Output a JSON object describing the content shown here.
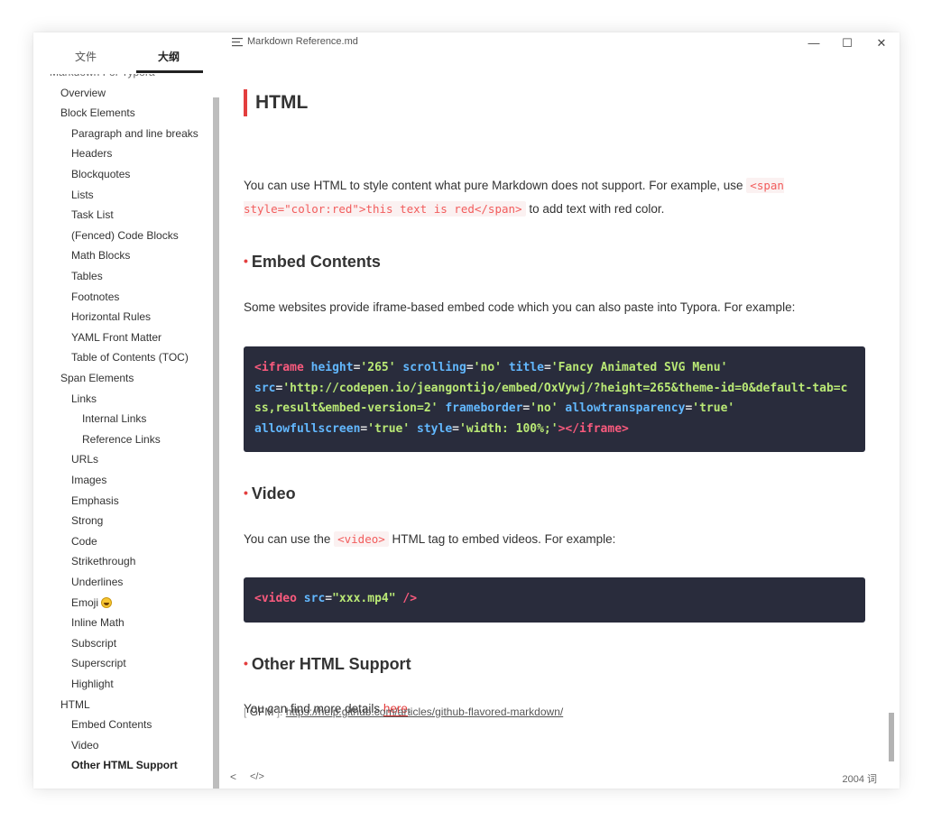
{
  "window": {
    "doc_title": "Markdown Reference.md",
    "buttons": {
      "minimize": "—",
      "maximize": "☐",
      "close": "✕"
    }
  },
  "sidebar": {
    "tabs": [
      {
        "label": "文件",
        "active": false
      },
      {
        "label": "大纲",
        "active": true
      }
    ],
    "outline": [
      {
        "label": "Markdown For Typora",
        "level": 0,
        "partial": true
      },
      {
        "label": "Overview",
        "level": 1
      },
      {
        "label": "Block Elements",
        "level": 1
      },
      {
        "label": "Paragraph and line breaks",
        "level": 2
      },
      {
        "label": "Headers",
        "level": 2
      },
      {
        "label": "Blockquotes",
        "level": 2
      },
      {
        "label": "Lists",
        "level": 2
      },
      {
        "label": "Task List",
        "level": 2
      },
      {
        "label": "(Fenced) Code Blocks",
        "level": 2
      },
      {
        "label": "Math Blocks",
        "level": 2
      },
      {
        "label": "Tables",
        "level": 2
      },
      {
        "label": "Footnotes",
        "level": 2
      },
      {
        "label": "Horizontal Rules",
        "level": 2
      },
      {
        "label": "YAML Front Matter",
        "level": 2
      },
      {
        "label": "Table of Contents (TOC)",
        "level": 2
      },
      {
        "label": "Span Elements",
        "level": 1
      },
      {
        "label": "Links",
        "level": 2
      },
      {
        "label": "Internal Links",
        "level": 3
      },
      {
        "label": "Reference Links",
        "level": 3
      },
      {
        "label": "URLs",
        "level": 2
      },
      {
        "label": "Images",
        "level": 2
      },
      {
        "label": "Emphasis",
        "level": 2
      },
      {
        "label": "Strong",
        "level": 2
      },
      {
        "label": "Code",
        "level": 2
      },
      {
        "label": "Strikethrough",
        "level": 2
      },
      {
        "label": "Underlines",
        "level": 2
      },
      {
        "label": "Emoji",
        "level": 2,
        "emoji": "grinning-face"
      },
      {
        "label": "Inline Math",
        "level": 2
      },
      {
        "label": "Subscript",
        "level": 2
      },
      {
        "label": "Superscript",
        "level": 2
      },
      {
        "label": "Highlight",
        "level": 2
      },
      {
        "label": "HTML",
        "level": 1
      },
      {
        "label": "Embed Contents",
        "level": 2
      },
      {
        "label": "Video",
        "level": 2
      },
      {
        "label": "Other HTML Support",
        "level": 2,
        "active": true
      }
    ]
  },
  "content": {
    "h1": "HTML",
    "intro": {
      "before": "You can use HTML to style content what pure Markdown does not support. For example, use ",
      "code": "<span style=\"color:red\">this text is red</span>",
      "after": " to add text with red color."
    },
    "embed": {
      "heading": "Embed Contents",
      "text": "Some websites provide iframe-based embed code which you can also paste into Typora. For example:",
      "code": [
        {
          "t": "tag",
          "v": "<iframe"
        },
        {
          "t": "pun",
          "v": " "
        },
        {
          "t": "attr",
          "v": "height"
        },
        {
          "t": "pun",
          "v": "="
        },
        {
          "t": "str",
          "v": "'265'"
        },
        {
          "t": "pun",
          "v": " "
        },
        {
          "t": "attr",
          "v": "scrolling"
        },
        {
          "t": "pun",
          "v": "="
        },
        {
          "t": "str",
          "v": "'no'"
        },
        {
          "t": "pun",
          "v": " "
        },
        {
          "t": "attr",
          "v": "title"
        },
        {
          "t": "pun",
          "v": "="
        },
        {
          "t": "str",
          "v": "'Fancy Animated SVG Menu'"
        },
        {
          "t": "pun",
          "v": "\n"
        },
        {
          "t": "attr",
          "v": "src"
        },
        {
          "t": "pun",
          "v": "="
        },
        {
          "t": "str",
          "v": "'http://codepen.io/jeangontijo/embed/OxVywj/?height=265&theme-id=0&default-tab=css,result&embed-version=2'"
        },
        {
          "t": "pun",
          "v": " "
        },
        {
          "t": "attr",
          "v": "frameborder"
        },
        {
          "t": "pun",
          "v": "="
        },
        {
          "t": "str",
          "v": "'no'"
        },
        {
          "t": "pun",
          "v": " "
        },
        {
          "t": "attr",
          "v": "allowtransparency"
        },
        {
          "t": "pun",
          "v": "="
        },
        {
          "t": "str",
          "v": "'true'"
        },
        {
          "t": "pun",
          "v": "\n"
        },
        {
          "t": "attr",
          "v": "allowfullscreen"
        },
        {
          "t": "pun",
          "v": "="
        },
        {
          "t": "str",
          "v": "'true'"
        },
        {
          "t": "pun",
          "v": " "
        },
        {
          "t": "attr",
          "v": "style"
        },
        {
          "t": "pun",
          "v": "="
        },
        {
          "t": "str",
          "v": "'width: 100%;'"
        },
        {
          "t": "tag",
          "v": "></iframe>"
        }
      ]
    },
    "video": {
      "heading": "Video",
      "before": "You can use the ",
      "code": "<video>",
      "after": " HTML tag to embed videos. For example:",
      "codeblock": [
        {
          "t": "tag",
          "v": "<video"
        },
        {
          "t": "pun",
          "v": " "
        },
        {
          "t": "attr",
          "v": "src"
        },
        {
          "t": "pun",
          "v": "="
        },
        {
          "t": "str",
          "v": "\"xxx.mp4\""
        },
        {
          "t": "pun",
          "v": " "
        },
        {
          "t": "tag",
          "v": "/>"
        }
      ]
    },
    "other": {
      "heading": "Other HTML Support",
      "before": "You can find more details ",
      "link": "here",
      "after": "."
    },
    "reference": {
      "open": "[",
      "label": "GFM",
      "close": "]:",
      "url": "https://help.github.com/articles/github-flavored-markdown/"
    }
  },
  "footer": {
    "back": "<",
    "code_toggle": "</>",
    "word_count": "2004 词"
  },
  "colors": {
    "accent": "#e33e3e",
    "code_bg": "#292c3c",
    "code_tag": "#f95a7d",
    "code_attr": "#62b8ff",
    "code_str": "#b9e875",
    "inline_code": "#f25c5c"
  }
}
